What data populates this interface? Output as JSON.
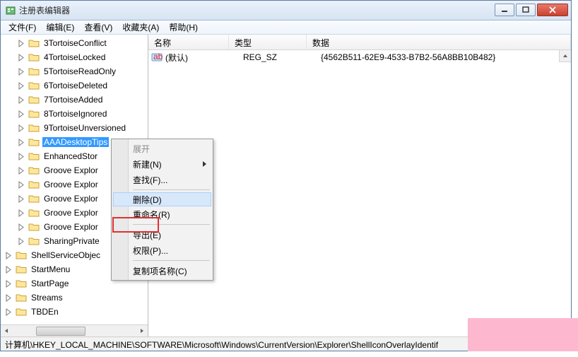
{
  "window": {
    "title": "注册表编辑器"
  },
  "menubar": {
    "items": [
      "文件(F)",
      "编辑(E)",
      "查看(V)",
      "收藏夹(A)",
      "帮助(H)"
    ]
  },
  "tree": {
    "items": [
      {
        "label": "3TortoiseConflict",
        "level": 2,
        "selected": false
      },
      {
        "label": "4TortoiseLocked",
        "level": 2,
        "selected": false
      },
      {
        "label": "5TortoiseReadOnly",
        "level": 2,
        "selected": false
      },
      {
        "label": "6TortoiseDeleted",
        "level": 2,
        "selected": false
      },
      {
        "label": "7TortoiseAdded",
        "level": 2,
        "selected": false
      },
      {
        "label": "8TortoiseIgnored",
        "level": 2,
        "selected": false
      },
      {
        "label": "9TortoiseUnversioned",
        "level": 2,
        "selected": false
      },
      {
        "label": "AAADesktopTips",
        "level": 2,
        "selected": true
      },
      {
        "label": "EnhancedStor",
        "level": 2,
        "selected": false
      },
      {
        "label": "Groove Explor",
        "level": 2,
        "selected": false
      },
      {
        "label": "Groove Explor",
        "level": 2,
        "selected": false
      },
      {
        "label": "Groove Explor",
        "level": 2,
        "selected": false
      },
      {
        "label": "Groove Explor",
        "level": 2,
        "selected": false
      },
      {
        "label": "Groove Explor",
        "level": 2,
        "selected": false
      },
      {
        "label": "SharingPrivate",
        "level": 2,
        "selected": false
      },
      {
        "label": "ShellServiceObjec",
        "level": 1,
        "selected": false
      },
      {
        "label": "StartMenu",
        "level": 1,
        "selected": false
      },
      {
        "label": "StartPage",
        "level": 1,
        "selected": false
      },
      {
        "label": "Streams",
        "level": 1,
        "selected": false
      },
      {
        "label": "TBDEn",
        "level": 1,
        "selected": false
      }
    ]
  },
  "list": {
    "columns": {
      "name": "名称",
      "type": "类型",
      "data": "数据"
    },
    "rows": [
      {
        "name": "(默认)",
        "type": "REG_SZ",
        "data": "{4562B511-62E9-4533-B7B2-56A8BB10B482}"
      }
    ]
  },
  "contextmenu": {
    "items": [
      {
        "label": "展开",
        "disabled": true
      },
      {
        "label": "新建(N)",
        "submenu": true
      },
      {
        "label": "查找(F)..."
      },
      {
        "sep": true
      },
      {
        "label": "删除(D)",
        "hover": true
      },
      {
        "label": "重命名(R)"
      },
      {
        "sep": true
      },
      {
        "label": "导出(E)"
      },
      {
        "label": "权限(P)..."
      },
      {
        "sep": true
      },
      {
        "label": "复制项名称(C)"
      }
    ]
  },
  "statusbar": {
    "path": "计算机\\HKEY_LOCAL_MACHINE\\SOFTWARE\\Microsoft\\Windows\\CurrentVersion\\Explorer\\ShellIconOverlayIdentif"
  }
}
